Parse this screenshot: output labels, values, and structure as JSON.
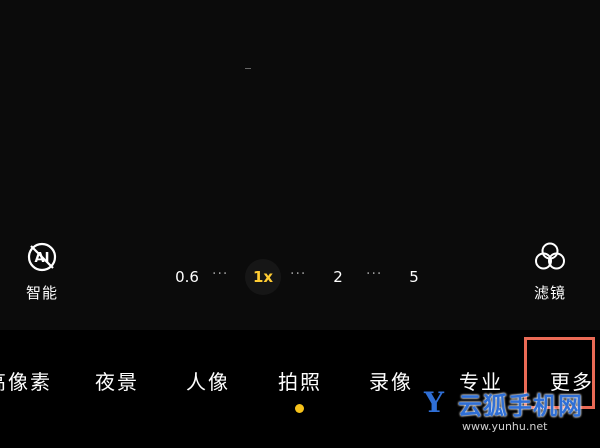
{
  "camera": {
    "ai_label": "智能",
    "filter_label": "滤镜",
    "ai_icon": "ai-off-icon",
    "filter_icon": "filter-icon"
  },
  "zoom": {
    "levels": [
      "0.6",
      "1x",
      "2",
      "5"
    ],
    "dots": "···",
    "selected": "1x",
    "selected_color": "#ffcc33"
  },
  "modes": [
    "高像素",
    "夜景",
    "人像",
    "拍照",
    "录像",
    "专业",
    "更多"
  ],
  "active_mode": "拍照",
  "indicator_color": "#f6c21a",
  "highlight_color": "#e96a55",
  "watermark": {
    "logo": "Y",
    "brand": "云狐手机网",
    "url": "www.yunhu.net"
  }
}
